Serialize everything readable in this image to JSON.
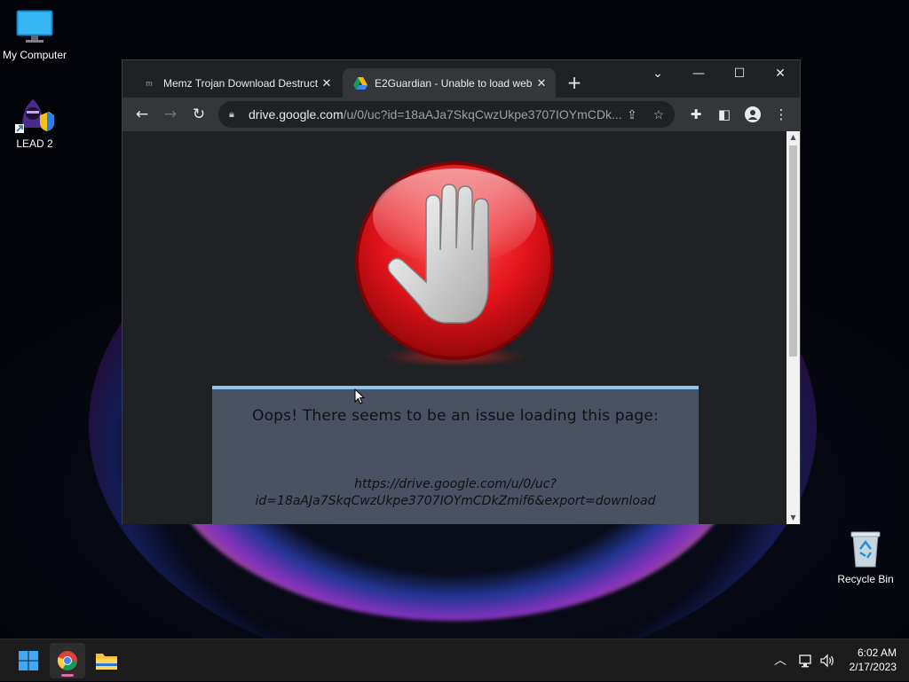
{
  "desktop": {
    "icons": [
      {
        "label": "My Computer"
      },
      {
        "label": "LEAD 2"
      },
      {
        "label": "Recycle Bin"
      }
    ]
  },
  "browser": {
    "tabs": [
      {
        "title": "Memz Trojan Download Destructi",
        "favicon_text": "m"
      },
      {
        "title": "E2Guardian - Unable to load web"
      }
    ],
    "address": {
      "host": "drive.google.com",
      "path": "/u/0/uc?id=18aAJa7SkqCwzUkpe3707IOYmCDk..."
    }
  },
  "page": {
    "heading": "Oops! There seems to be an issue loading this page:",
    "url_line1": "https://drive.google.com/u/0/uc?",
    "url_line2": "id=18aAJa7SkqCwzUkpe3707IOYmCDkZmif6&export=download"
  },
  "taskbar": {
    "time": "6:02 AM",
    "date": "2/17/2023"
  },
  "colors": {
    "card_bg": "#495163",
    "card_border": "#8ec5f0",
    "stop_red": "#e3141b"
  }
}
